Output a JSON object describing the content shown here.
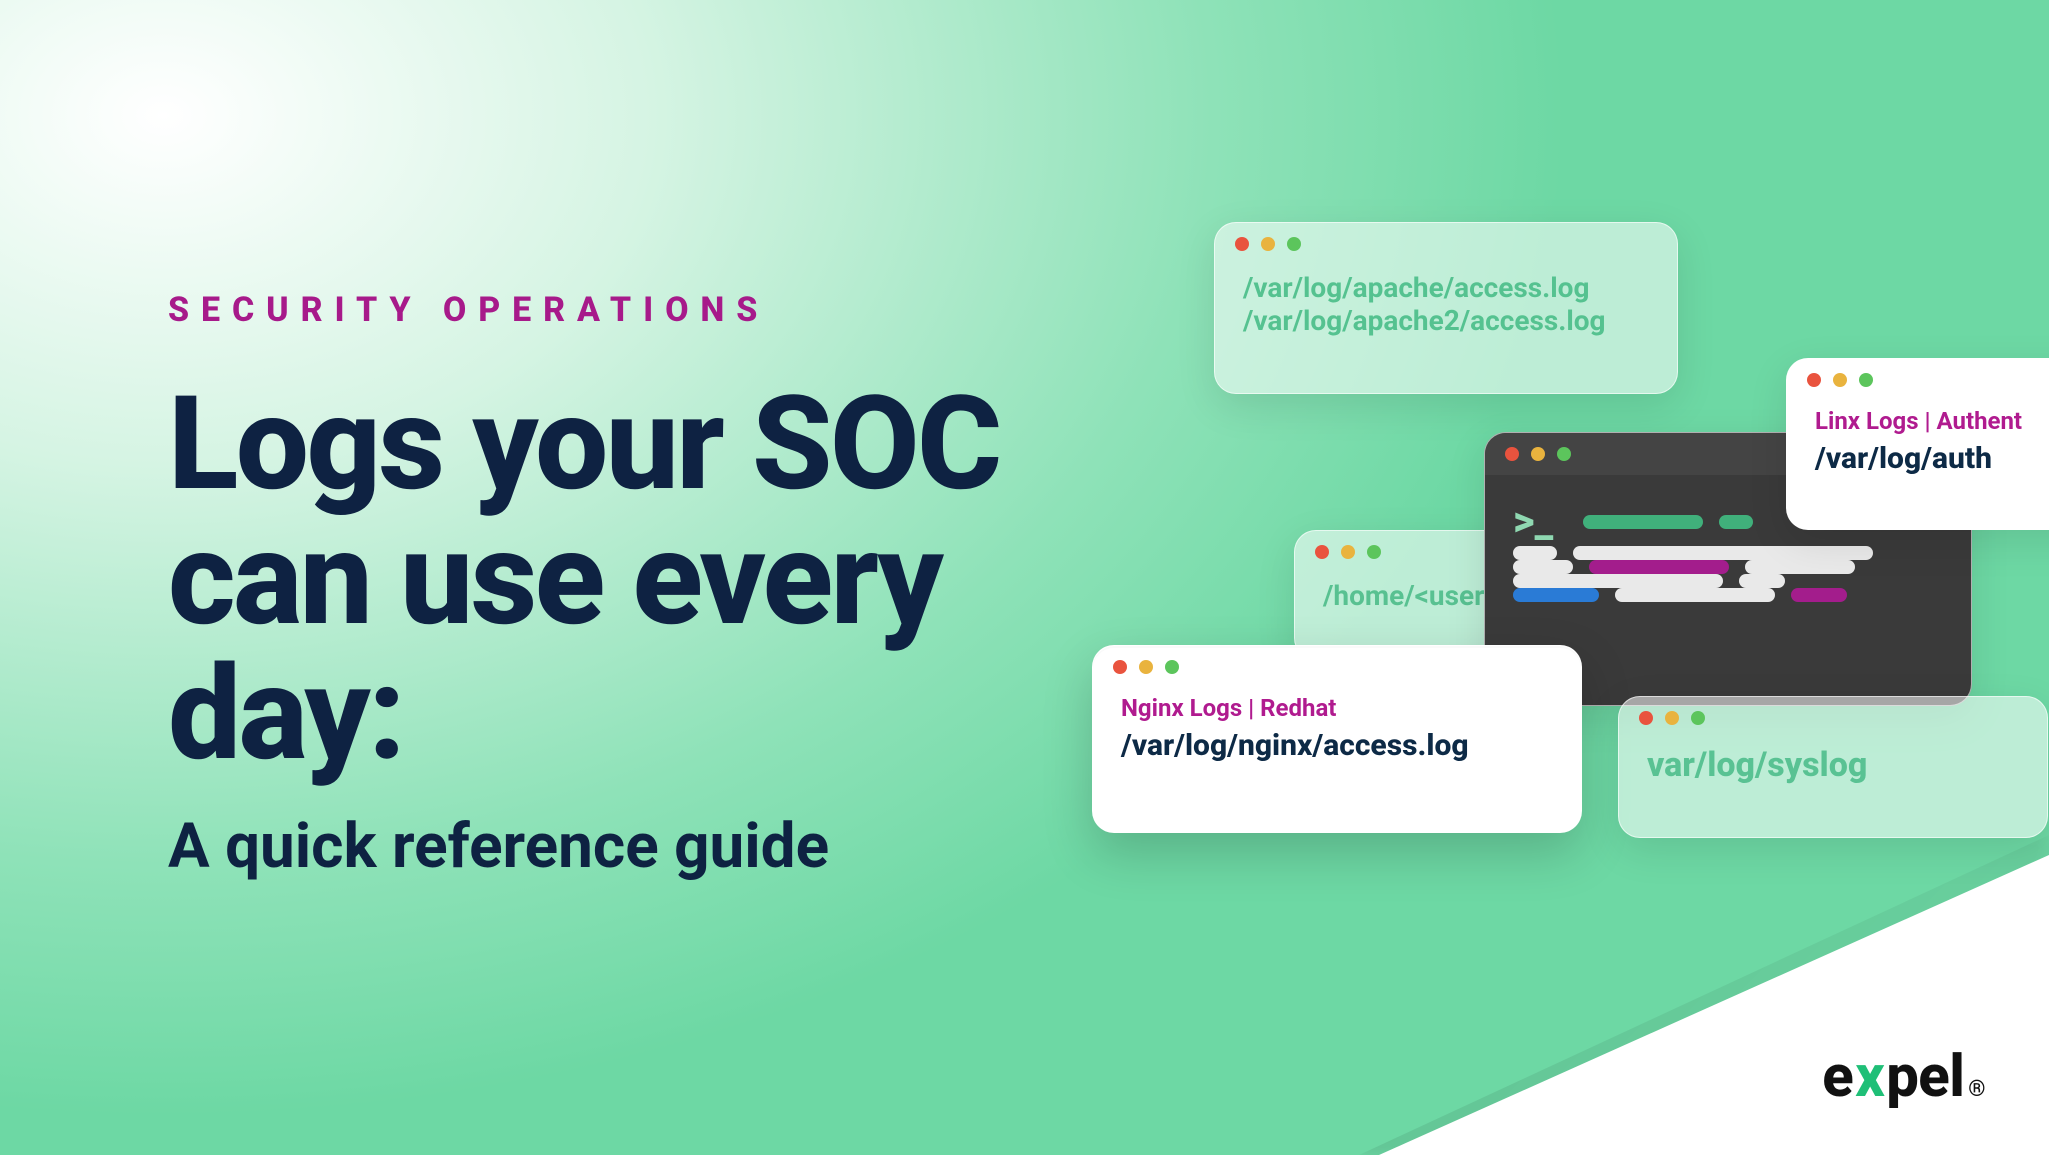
{
  "eyebrow": "SECURITY OPERATIONS",
  "title": "Logs your SOC can use every day:",
  "subtitle": "A quick reference guide",
  "apache": {
    "line1": "/var/log/apache/access.log",
    "line2": "/var/log/apache2/access.log"
  },
  "home": {
    "line1": "/home/<usern"
  },
  "nginx": {
    "caption": "Nginx Logs | Redhat",
    "path": "/var/log/nginx/access.log"
  },
  "linx": {
    "caption": "Linx Logs | Authent",
    "path": "/var/log/auth"
  },
  "syslog": {
    "line1": "var/log/syslog"
  },
  "logo": {
    "pre": "e",
    "x": "x",
    "post": "pel",
    "mark": "®"
  }
}
